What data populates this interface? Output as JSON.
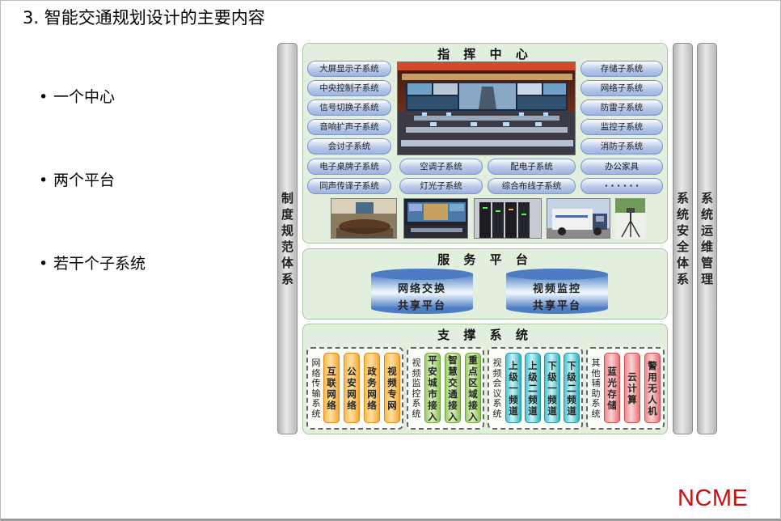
{
  "title": "3. 智能交通规划设计的主要内容",
  "bullets": [
    "一个中心",
    "两个平台",
    "若干个子系统"
  ],
  "logo": "NCME",
  "side_left": "制度规范体系",
  "side_right1": "系统安全体系",
  "side_right2": "系统运维管理",
  "command_center": {
    "title": "指 挥 中 心",
    "left_items": [
      "大屏显示子系统",
      "中央控制子系统",
      "信号切换子系统",
      "音响扩声子系统",
      "会讨子系统"
    ],
    "right_items": [
      "存储子系统",
      "网络子系统",
      "防雷子系统",
      "监控子系统",
      "消防子系统"
    ],
    "row1": [
      "电子桌牌子系统",
      "空调子系统",
      "配电子系统",
      "办公家具"
    ],
    "row2": [
      "同声传译子系统",
      "灯光子系统",
      "综合布线子系统",
      "· · · · · ·"
    ]
  },
  "service_platform": {
    "title": "服 务 平 台",
    "platforms": [
      {
        "line1": "网络交换",
        "line2": "共享平台"
      },
      {
        "line1": "视频监控",
        "line2": "共享平台"
      }
    ]
  },
  "support": {
    "title": "支 撑 系 统",
    "groups": [
      {
        "label": "网络传输系统",
        "items": [
          "互联网络",
          "公安网络",
          "政务网络",
          "视频专网"
        ],
        "color": "orange"
      },
      {
        "label": "视频监控系统",
        "items": [
          "平安城市接入",
          "智慧交通接入",
          "重点区域接入"
        ],
        "color": "green"
      },
      {
        "label": "视频会议系统",
        "items": [
          "上级一频道",
          "上级二频道",
          "下级一频道",
          "下级二频道"
        ],
        "color": "teal"
      },
      {
        "label": "其他辅助系统",
        "items": [
          "蓝光存储",
          "云计算",
          "警用无人机"
        ],
        "color": "pink"
      }
    ]
  },
  "photo_names": [
    "command-hall-photo",
    "meeting-room-photo",
    "video-wall-photo",
    "server-rack-photo",
    "plant-photo",
    "command-vehicle-photo",
    "camera-tripod-photo"
  ]
}
